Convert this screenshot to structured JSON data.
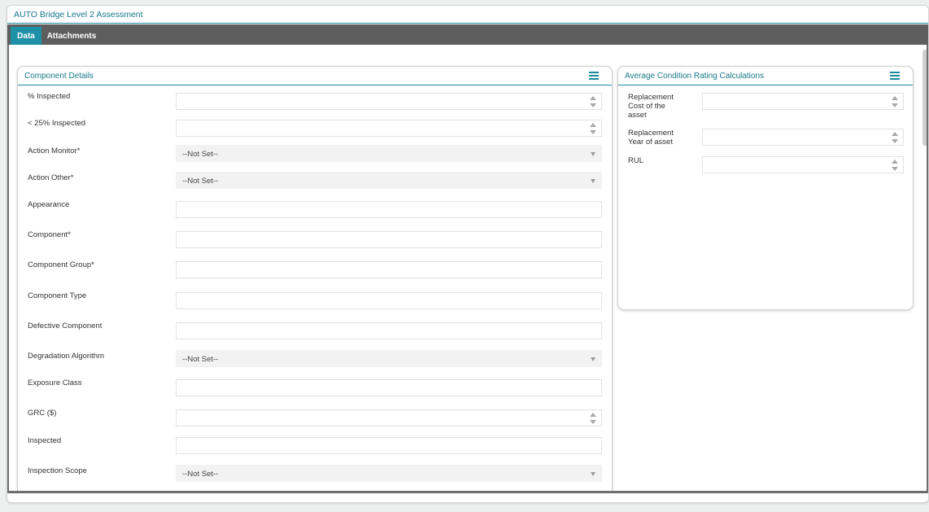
{
  "window": {
    "title": "AUTO Bridge Level 2 Assessment"
  },
  "tabs": [
    {
      "label": "Data",
      "active": true
    },
    {
      "label": "Attachments",
      "active": false
    }
  ],
  "component_details": {
    "title": "Component Details",
    "menu_icon": "hamburger-menu-icon",
    "fields": [
      {
        "label": "% Inspected",
        "type": "number",
        "value": ""
      },
      {
        "label": "< 25% Inspected",
        "type": "number",
        "value": ""
      },
      {
        "label": "Action Monitor*",
        "type": "select",
        "value": "--Not Set--"
      },
      {
        "label": "Action Other*",
        "type": "select",
        "value": "--Not Set--"
      },
      {
        "label": "Appearance",
        "type": "text",
        "value": ""
      },
      {
        "label": "Component*",
        "type": "text",
        "value": ""
      },
      {
        "label": "Component Group*",
        "type": "text",
        "value": ""
      },
      {
        "label": "Component Type",
        "type": "text",
        "value": ""
      },
      {
        "label": "Defective Component",
        "type": "text",
        "value": ""
      },
      {
        "label": "Degradation Algorithm",
        "type": "select",
        "value": "--Not Set--"
      },
      {
        "label": "Exposure Class",
        "type": "text",
        "value": ""
      },
      {
        "label": "GRC ($)",
        "type": "number",
        "value": ""
      },
      {
        "label": "Inspected",
        "type": "text",
        "value": ""
      },
      {
        "label": "Inspection Scope",
        "type": "select",
        "value": "--Not Set--"
      }
    ]
  },
  "avg_condition": {
    "title": "Average Condition Rating Calculations",
    "menu_icon": "hamburger-menu-icon",
    "fields": [
      {
        "label": "Replacement Cost of the asset",
        "type": "number",
        "value": ""
      },
      {
        "label": "Replacement Year of asset",
        "type": "number",
        "value": ""
      },
      {
        "label": "RUL",
        "type": "number",
        "value": ""
      }
    ]
  },
  "colors": {
    "accent": "#1e91a6",
    "title_text": "#17798a",
    "tabbar": "#5e5e5e"
  }
}
